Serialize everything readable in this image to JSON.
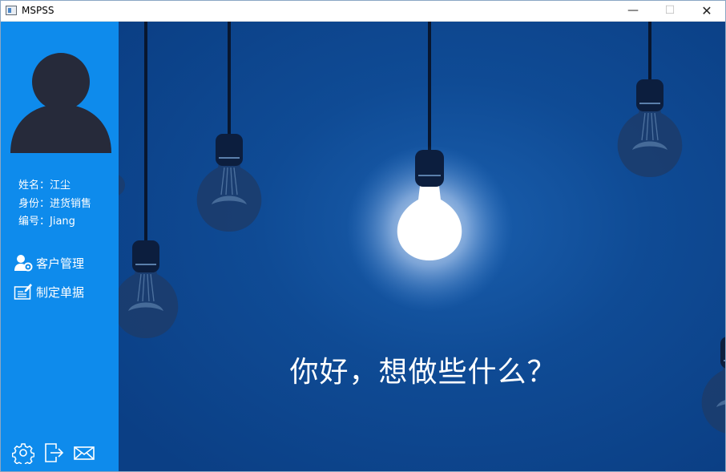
{
  "window": {
    "title": "MSPSS",
    "controls": {
      "minimize": "—",
      "maximize": "☐",
      "close": "✕"
    }
  },
  "sidebar": {
    "user": {
      "name_line": "姓名：江尘",
      "role_line": "身份：进货销售",
      "id_line": "编号：Jiang"
    },
    "nav": [
      {
        "label": "客户管理",
        "icon": "customer-manage-icon"
      },
      {
        "label": "制定单据",
        "icon": "edit-document-icon"
      }
    ],
    "bottom_icons": [
      "gear-icon",
      "exit-icon",
      "mail-icon"
    ]
  },
  "main": {
    "greeting": "你好，想做些什么？"
  },
  "colors": {
    "sidebar": "#0e8bec",
    "stage": "#0f4b95",
    "bulb_dim": "#1b3d6e",
    "bulb_lit": "#ffffff"
  }
}
